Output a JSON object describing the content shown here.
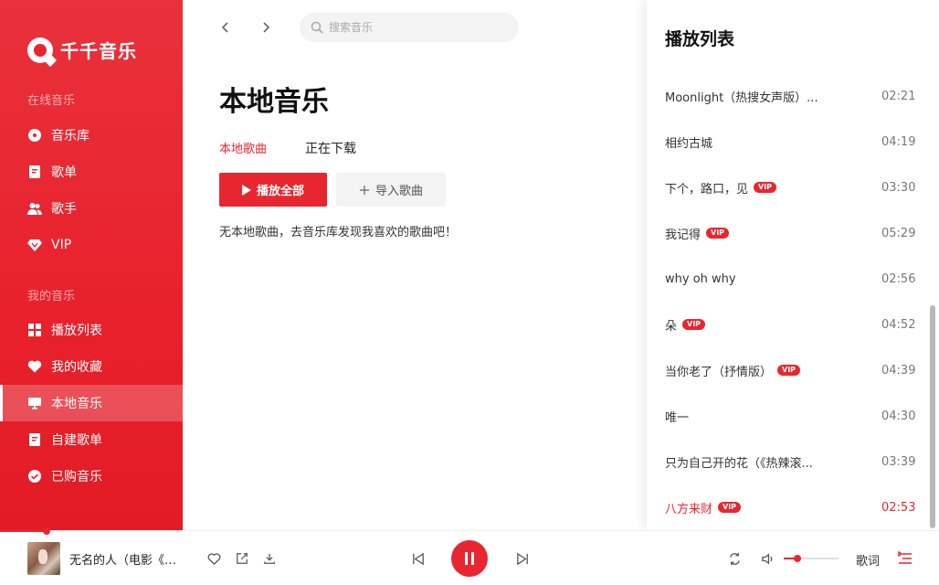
{
  "sidebar": {
    "logo_text": "千千音乐",
    "online_section": "在线音乐",
    "my_section": "我的音乐",
    "online_items": [
      {
        "label": "音乐库",
        "icon": "disc-icon"
      },
      {
        "label": "歌单",
        "icon": "playlist-doc-icon"
      },
      {
        "label": "歌手",
        "icon": "singer-icon"
      },
      {
        "label": "VIP",
        "icon": "diamond-icon"
      }
    ],
    "my_items": [
      {
        "label": "播放列表",
        "icon": "grid-icon"
      },
      {
        "label": "我的收藏",
        "icon": "heart-icon"
      },
      {
        "label": "本地音乐",
        "icon": "monitor-icon",
        "active": true
      },
      {
        "label": "自建歌单",
        "icon": "doc-icon"
      },
      {
        "label": "已购音乐",
        "icon": "check-circle-icon"
      }
    ]
  },
  "topbar": {
    "search_placeholder": "搜索音乐"
  },
  "main": {
    "title": "本地音乐",
    "tabs": [
      {
        "label": "本地歌曲",
        "active": true
      },
      {
        "label": "正在下载",
        "active": false
      }
    ],
    "play_all_label": "播放全部",
    "import_label": "导入歌曲",
    "empty_hint": "无本地歌曲，去音乐库发现我喜欢的歌曲吧！"
  },
  "playlist": {
    "title": "播放列表",
    "items": [
      {
        "name": "Moonlight（热搜女声版）...",
        "duration": "02:21",
        "vip": false
      },
      {
        "name": "相约古城",
        "duration": "04:19",
        "vip": false
      },
      {
        "name": "下个，路口，见",
        "duration": "03:30",
        "vip": true
      },
      {
        "name": "我记得",
        "duration": "05:29",
        "vip": true
      },
      {
        "name": "why oh why",
        "duration": "02:56",
        "vip": false
      },
      {
        "name": "朵",
        "duration": "04:52",
        "vip": true
      },
      {
        "name": "当你老了（抒情版）",
        "duration": "04:39",
        "vip": true
      },
      {
        "name": "唯一",
        "duration": "04:30",
        "vip": false
      },
      {
        "name": "只为自己开的花（《热辣滚...",
        "duration": "03:39",
        "vip": false
      },
      {
        "name": "八方来财",
        "duration": "02:53",
        "vip": true,
        "current": true
      }
    ],
    "vip_badge": "VIP"
  },
  "player": {
    "now_playing": "无名的人（电影《雄狮少年》主题曲）",
    "lyrics_label": "歌词",
    "volume": 0.25,
    "progress": 0.05
  },
  "colors": {
    "accent": "#e8262f"
  }
}
